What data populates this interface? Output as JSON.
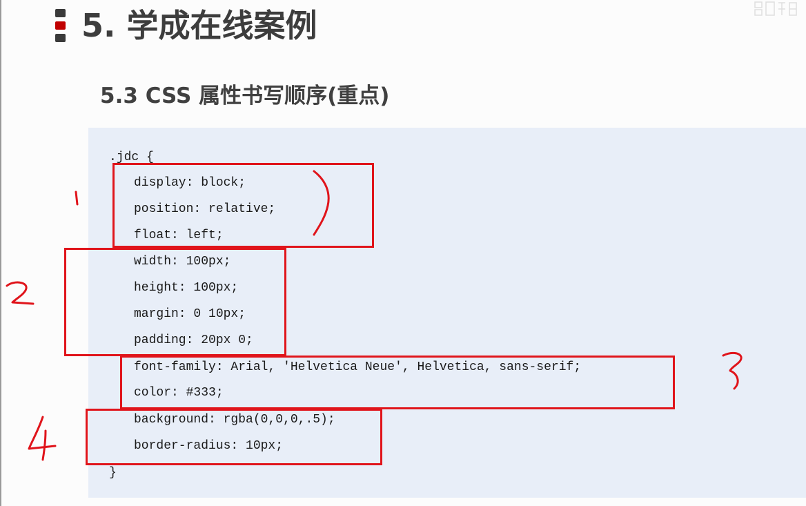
{
  "header": {
    "title": "5. 学成在线案例",
    "subtitle": "5.3 CSS 属性书写顺序(重点)"
  },
  "code": {
    "selector_open": ".jdc {",
    "lines": [
      "display: block;",
      "position: relative;",
      "float: left;",
      "width: 100px;",
      "height: 100px;",
      "margin: 0 10px;",
      "padding: 20px 0;",
      "font-family: Arial, 'Helvetica Neue', Helvetica, sans-serif;",
      "color: #333;",
      "background: rgba(0,0,0,.5);",
      "border-radius: 10px;"
    ],
    "selector_close": "}"
  },
  "annotations": {
    "color": "#e0141b",
    "group_numbers": [
      "1",
      "2",
      "3",
      "4"
    ]
  },
  "colors": {
    "code_background": "#e8eef8",
    "bullet_accent": "#c00000",
    "title_text": "#3d3d3d"
  }
}
